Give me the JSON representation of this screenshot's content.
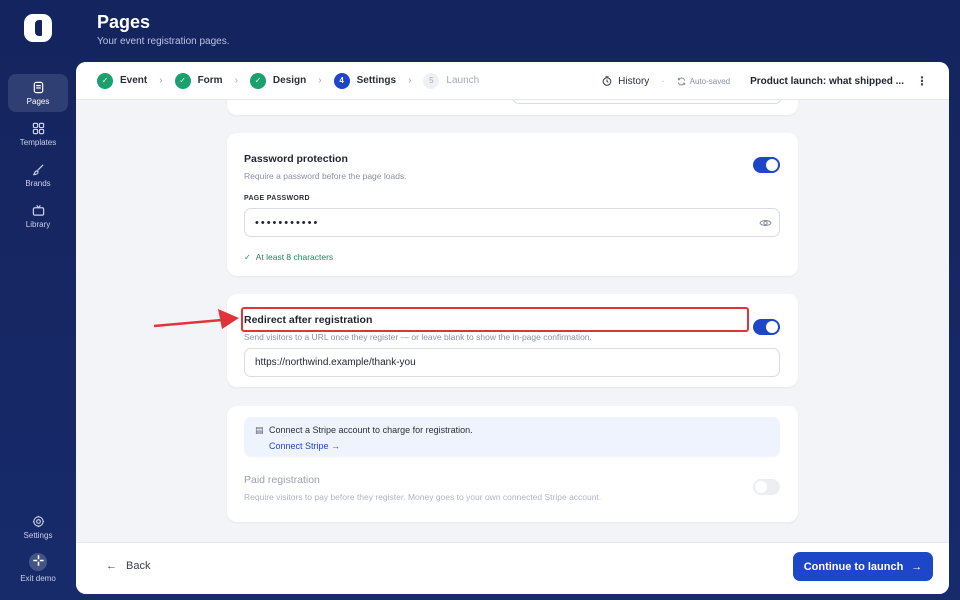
{
  "app": {
    "title": "Pages",
    "subtitle": "Your event registration pages."
  },
  "sidebar": {
    "items": [
      {
        "label": "Pages",
        "icon": "pages-icon",
        "active": true
      },
      {
        "label": "Templates",
        "icon": "grid-icon",
        "active": false
      },
      {
        "label": "Brands",
        "icon": "brush-icon",
        "active": false
      },
      {
        "label": "Library",
        "icon": "tv-icon",
        "active": false
      }
    ],
    "bottom": [
      {
        "label": "Settings",
        "icon": "gear-icon"
      },
      {
        "label": "Exit demo",
        "icon": "exit-icon"
      }
    ]
  },
  "stepper": {
    "steps": [
      {
        "number": "1",
        "label": "Event",
        "state": "done"
      },
      {
        "number": "2",
        "label": "Form",
        "state": "done"
      },
      {
        "number": "3",
        "label": "Design",
        "state": "done"
      },
      {
        "number": "4",
        "label": "Settings",
        "state": "current"
      },
      {
        "number": "5",
        "label": "Launch",
        "state": "future"
      }
    ],
    "history_label": "History",
    "autosave_label": "Auto-saved",
    "project_title": "Product launch: what shipped ..."
  },
  "password_card": {
    "title": "Password protection",
    "description": "Require a password before the page loads.",
    "enabled": true,
    "field_label": "PAGE PASSWORD",
    "value": "•••••••••••",
    "hint": "At least 8 characters"
  },
  "redirect_card": {
    "title": "Redirect after registration",
    "description": "Send visitors to a URL once they register — or leave blank to show the in-page confirmation.",
    "enabled": true,
    "url": "https://northwind.example/thank-you"
  },
  "payment_card": {
    "stripe_notice": "Connect a Stripe account to charge for registration.",
    "connect_link": "Connect Stripe →",
    "title": "Paid registration",
    "description": "Require visitors to pay before they register. Money goes to your own connected Stripe account.",
    "enabled": false
  },
  "footer": {
    "back_label": "Back",
    "continue_label": "Continue to launch"
  },
  "colors": {
    "brand": "#1e46c8",
    "sidebar_bg": "#14245e",
    "success": "#1aa06d",
    "highlight": "#e0343d"
  }
}
